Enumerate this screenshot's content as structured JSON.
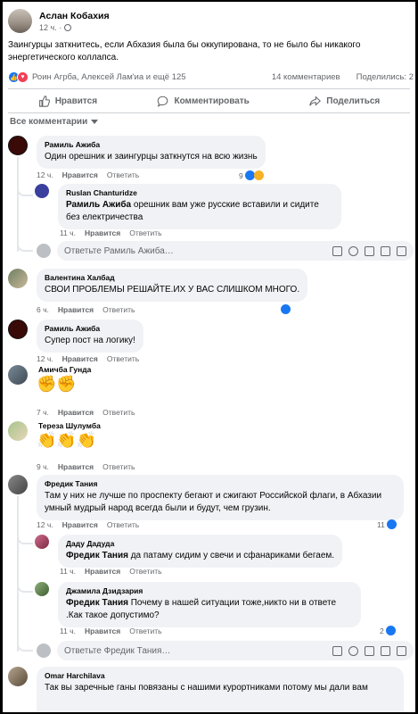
{
  "post": {
    "author": "Аслан Кобахия",
    "time": "12 ч. ·",
    "text": "Заингурцы заткнитесь, если Абхазия была бы оккупирована, то не было бы никакого энергетического коллапса.",
    "reaction_names": "Роин Агрба, Алексей Лам'иа и ещё 125",
    "comments_count": "14 комментариев",
    "shares": "Поделились: 2"
  },
  "actions": {
    "like": "Нравится",
    "comment": "Комментировать",
    "share": "Поделиться"
  },
  "filter_label": "Все комментарии",
  "comments": [
    {
      "name": "Рамиль Ажиба",
      "text": "Один орешник и заингурцы заткнутся на всю жизнь",
      "time": "12 ч.",
      "like": "Нравится",
      "reply": "Ответить",
      "count": "9"
    },
    {
      "name": "Ruslan Chanturidze",
      "mention": "Рамиль Ажиба",
      "text": " орешник вам уже русские вставили и сидите без електричества",
      "time": "11 ч.",
      "like": "Нравится",
      "reply": "Ответить"
    },
    {
      "name": "Валентина Халбад",
      "text": "СВОИ ПРОБЛЕМЫ РЕШАЙТЕ.ИХ У ВАС СЛИШКОМ МНОГО.",
      "time": "6 ч.",
      "like": "Нравится",
      "reply": "Ответить"
    },
    {
      "name": "Рамиль Ажиба",
      "text": "Супер пост на логику!",
      "time": "12 ч.",
      "like": "Нравится",
      "reply": "Ответить"
    },
    {
      "name": "Амичба Гунда",
      "text": "✊✊",
      "time": "7 ч.",
      "like": "Нравится",
      "reply": "Ответить"
    },
    {
      "name": "Тереза Шулумба",
      "text": "👏👏👏",
      "time": "9 ч.",
      "like": "Нравится",
      "reply": "Ответить"
    },
    {
      "name": "Фредик Тания",
      "text": "Там у них не лучше по проспекту бегают и сжигают Российской флаги, в Абхазии умный мудрый народ всегда были и будут, чем грузин.",
      "time": "12 ч.",
      "like": "Нравится",
      "reply": "Ответить",
      "count": "11"
    },
    {
      "name": "Даду Дадуда",
      "mention": "Фредик Тания",
      "text": " да патаму сидим у свечи и сфанариками бегаем.",
      "time": "11 ч.",
      "like": "Нравится",
      "reply": "Ответить"
    },
    {
      "name": "Джамила Дзидзария",
      "mention": "Фредик Тания",
      "text": " Почему в нашей ситуации тоже,никто ни в ответе .Как такое допустимо?",
      "time": "11 ч.",
      "like": "Нравится",
      "reply": "Ответить",
      "count": "2"
    },
    {
      "name": "Omar Harchilava",
      "text": "Так вы заречные ганы повязаны с нашими курортниками потому мы дали вам"
    }
  ],
  "reply_placeholders": {
    "first": "Ответьте Рамиль Ажиба…",
    "second": "Ответьте Фредик Тания…"
  },
  "colors": {
    "accent": "#1877f2",
    "bubble": "#f0f2f5",
    "meta": "#65676b"
  }
}
